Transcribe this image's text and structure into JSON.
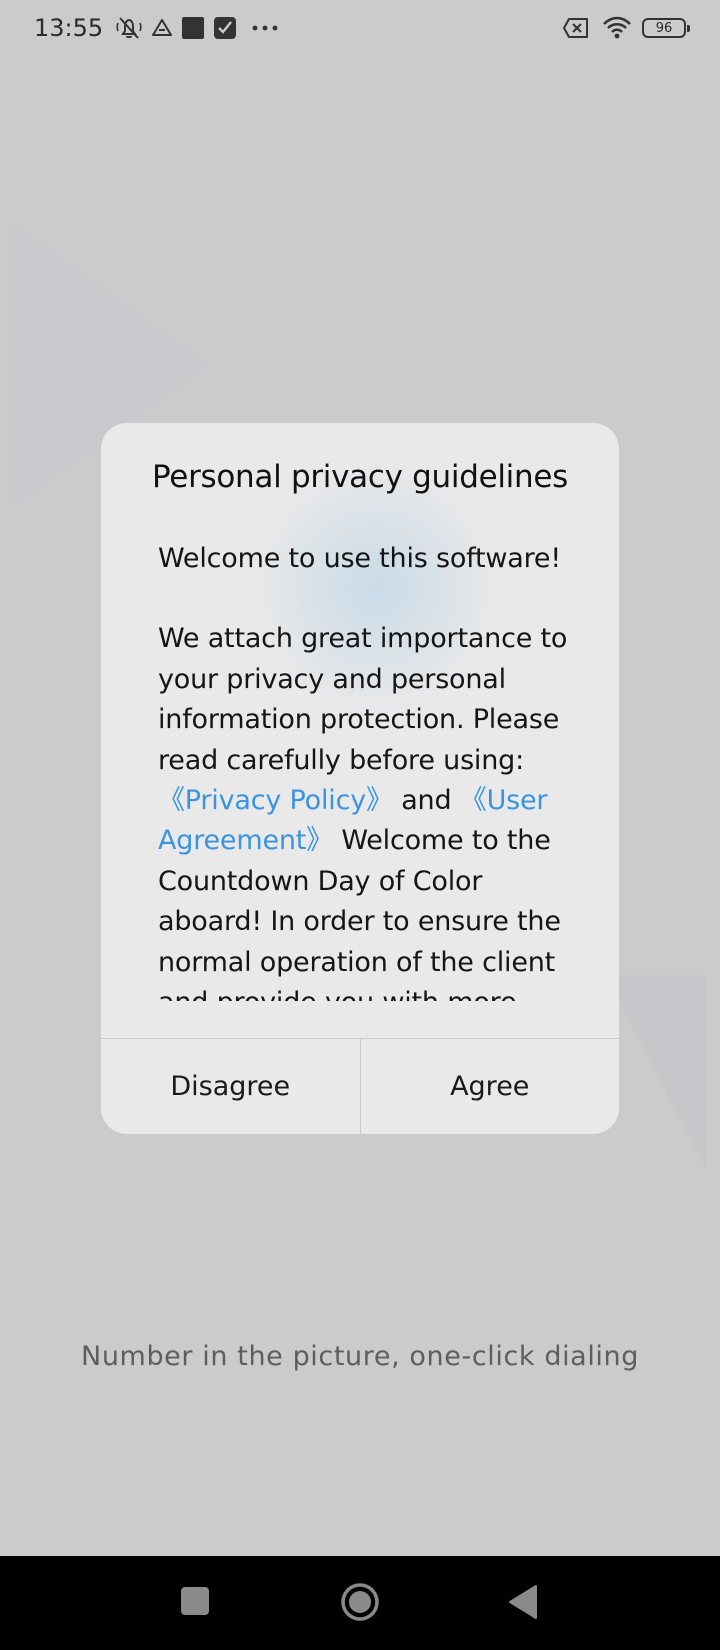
{
  "status_bar": {
    "time": "13:55",
    "left_icons": [
      "bell-off-icon",
      "drive-icon",
      "square-app-icon",
      "check-app-icon",
      "more-dots-icon"
    ],
    "right_icons": [
      "no-sim-icon",
      "wifi-icon"
    ],
    "battery": "96"
  },
  "dialog": {
    "title": "Personal privacy guidelines",
    "welcome": "Welcome to use this software!",
    "body_intro": "We attach great importance to your privacy and personal information protection. Please read carefully before using:",
    "privacy_link": "《Privacy Policy》",
    "and_text": " and ",
    "agreement_link": "《User Agreement》",
    "body_rest": " Welcome to the Countdown Day of Color aboard! In order to ensure the normal operation of the client and provide you with more",
    "disagree_label": "Disagree",
    "agree_label": "Agree"
  },
  "tagline": "Number in the picture, one-click dialing",
  "nav_bar": {
    "icons": [
      "recents-icon",
      "home-icon",
      "back-icon"
    ]
  },
  "colors": {
    "background": "#cbcbcb",
    "dialog": "#e9e9e9",
    "link": "#3a94e0",
    "nav_bar": "#000000"
  }
}
